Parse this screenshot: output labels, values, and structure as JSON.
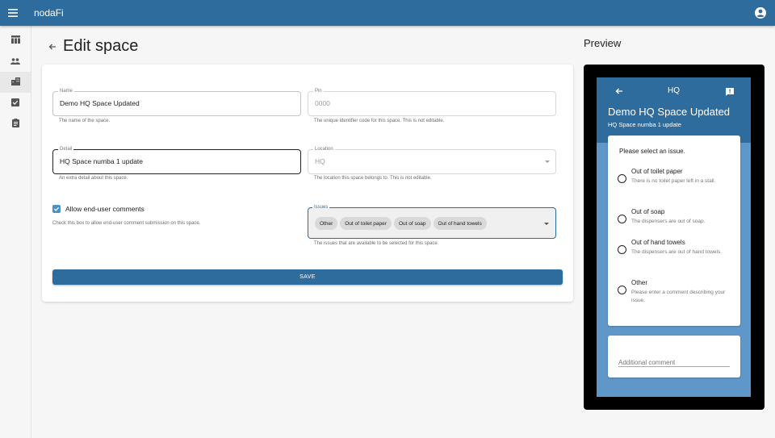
{
  "app": {
    "title": "nodaFi"
  },
  "icons": {
    "menu": "menu-icon",
    "account": "account-circle-icon",
    "nav": [
      "table-icon",
      "people-icon",
      "building-icon",
      "checkbox-icon",
      "clipboard-icon"
    ],
    "back": "arrow-back-icon",
    "feedback": "feedback-icon"
  },
  "colors": {
    "primary": "#2f6c9e",
    "preview_bg": "#5f97c8",
    "checkbox": "#4a90c8"
  },
  "page": {
    "title": "Edit space",
    "preview_title": "Preview"
  },
  "form": {
    "name": {
      "label": "Name",
      "value": "Demo HQ Space Updated",
      "helper": "The name of the space."
    },
    "pin": {
      "label": "Pin",
      "value": "0000",
      "helper": "The unique identifier code for this space. This is not editable."
    },
    "detail": {
      "label": "Detail",
      "value": "HQ Space numba 1 update",
      "helper": "An extra detail about this space."
    },
    "location": {
      "label": "Location",
      "value": "HQ",
      "helper": "The location this space belongs to. This is not editable."
    },
    "comments": {
      "label": "Allow end-user comments",
      "helper": "Check this box to allow end-user comment submission on this space.",
      "checked": true
    },
    "issues": {
      "label": "Issues",
      "chips": [
        "Other",
        "Out of toilet paper",
        "Out of soap",
        "Out of hand towels"
      ],
      "helper": "The issues that are available to be selected for this space."
    },
    "save_label": "SAVE"
  },
  "preview": {
    "header_title": "HQ",
    "space_name": "Demo HQ Space Updated",
    "space_detail": "HQ Space numba 1 update",
    "prompt": "Please select an issue.",
    "options": [
      {
        "label": "Out of toilet paper",
        "desc": "There is no toilet paper left in a stall."
      },
      {
        "label": "Out of soap",
        "desc": "The dispensers are out of soap."
      },
      {
        "label": "Out of hand towels",
        "desc": "The dispensers are out of hand towels."
      },
      {
        "label": "Other",
        "desc": "Please enter a comment describing your issue."
      }
    ],
    "comment_placeholder": "Additional comment"
  }
}
